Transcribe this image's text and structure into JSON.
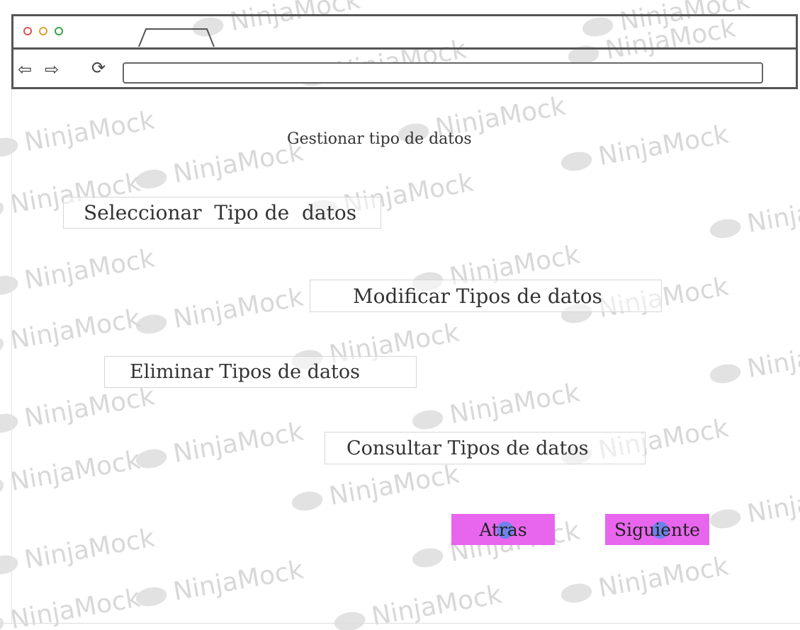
{
  "watermark_text": "NinjaMock",
  "page": {
    "title": "Gestionar tipo de datos"
  },
  "options": {
    "select": "Seleccionar  Tipo de  datos",
    "modify": "Modificar Tipos de datos",
    "delete": "Eliminar Tipos de datos",
    "consult": "Consultar Tipos de datos"
  },
  "navigation": {
    "back": "Atras",
    "next": "Siguiente"
  },
  "colors": {
    "action_button": "#e866ee",
    "cursor_indicator": "#468ce6",
    "frame": "#555555"
  },
  "icons": [
    "close-dot",
    "minimize-dot",
    "maximize-dot",
    "back-arrow-icon",
    "forward-arrow-icon",
    "reload-icon"
  ]
}
